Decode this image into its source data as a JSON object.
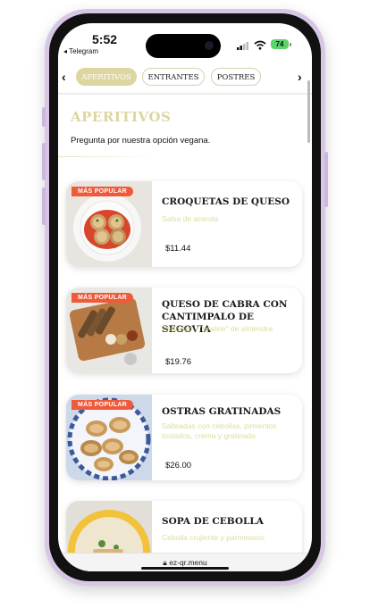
{
  "status": {
    "time": "5:52",
    "back_app": "◂ Telegram",
    "battery": "74"
  },
  "nav": {
    "prev_icon": "‹",
    "next_icon": "›",
    "tabs": [
      {
        "label": "APERITIVOS"
      },
      {
        "label": "ENTRANTES"
      },
      {
        "label": "POSTRES"
      }
    ]
  },
  "section": {
    "title": "APERITIVOS",
    "description": "Pregunta por nuestra opción vegana."
  },
  "items": [
    {
      "badge": "MÁS POPULAR",
      "name": "CROQUETAS DE QUESO",
      "description": "Salsa de acerola",
      "price": "$11.44"
    },
    {
      "badge": "MÁS POPULAR",
      "name": "QUESO DE CABRA CON CANTIMPALO DE SEGOVIA",
      "description": "Tostadas y \"praline\" de almendra",
      "price": "$19.76"
    },
    {
      "badge": "MÁS POPULAR",
      "name": "OSTRAS GRATINADAS",
      "description": "Salteadas con cebollas, pimientos tostados, crema y gratinada",
      "price": "$26.00"
    },
    {
      "name": "SOPA DE CEBOLLA",
      "description": "Cebolla crujiente y parmesano"
    }
  ],
  "browser": {
    "url": "ez-qr.menu"
  },
  "colors": {
    "accent": "#ddd6a0",
    "badge": "#ef5a3a",
    "frame": "#d8c6e6"
  }
}
